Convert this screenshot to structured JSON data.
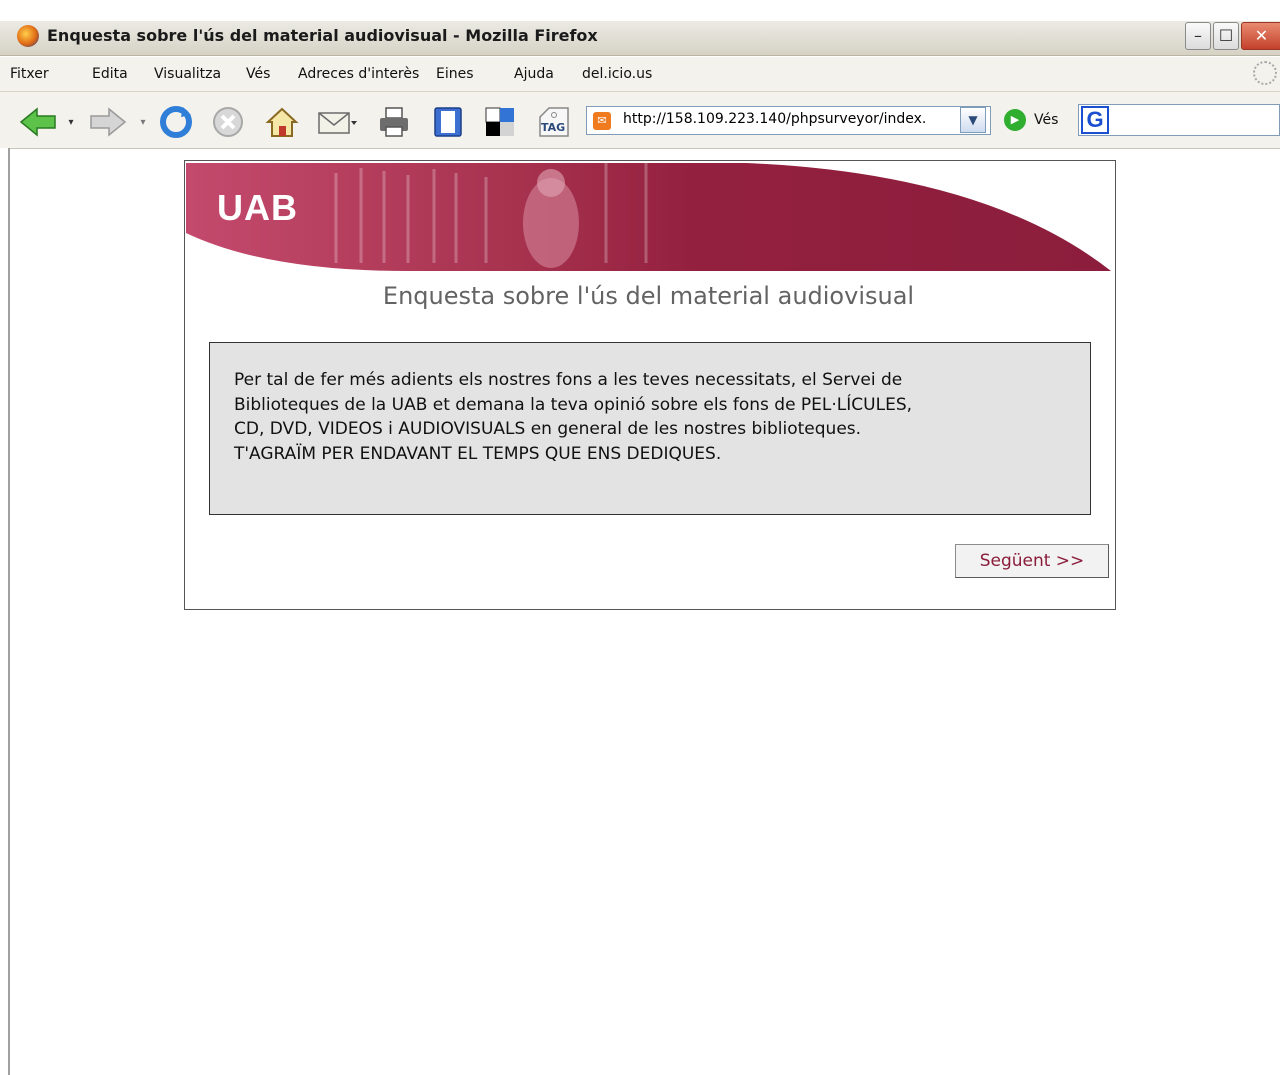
{
  "window": {
    "title": "Enquesta sobre l'ús del material audiovisual - Mozilla Firefox",
    "controls": {
      "minimize": "–",
      "maximize": "☐",
      "close": "✕"
    }
  },
  "menu": {
    "items": [
      "Fitxer",
      "Edita",
      "Visualitza",
      "Vés",
      "Adreces d'interès",
      "Eines",
      "Ajuda",
      "del.icio.us"
    ]
  },
  "toolbar": {
    "buttons": [
      "back-icon",
      "dropdown-arrow-icon",
      "forward-icon",
      "dropdown-arrow-icon",
      "reload-icon",
      "stop-icon",
      "home-icon",
      "mail-icon",
      "print-icon",
      "bookmarks-icon",
      "delicious-icon",
      "tag-icon"
    ],
    "tag_label": "TAG",
    "url": "http://158.109.223.140/phpsurveyor/index.",
    "go_label": "Vés",
    "search_placeholder": ""
  },
  "page": {
    "logo": "UAB",
    "title": "Enquesta sobre l'ús del material audiovisual",
    "welcome_lines": [
      "Per tal de fer més adients els nostres fons a les teves necessitats, el Servei de",
      "Biblioteques de la UAB et demana la teva opinió sobre els fons de PEL·LÍCULES,",
      "CD, DVD, VIDEOS i AUDIOVISUALS en general de les nostres biblioteques.",
      "T'AGRAÏM PER ENDAVANT EL TEMPS QUE ENS DEDIQUES."
    ],
    "next_button": "Següent >>"
  },
  "colors": {
    "brand": "#8c1d3c",
    "title_text": "#636363",
    "welcome_bg": "#e3e3e3"
  }
}
